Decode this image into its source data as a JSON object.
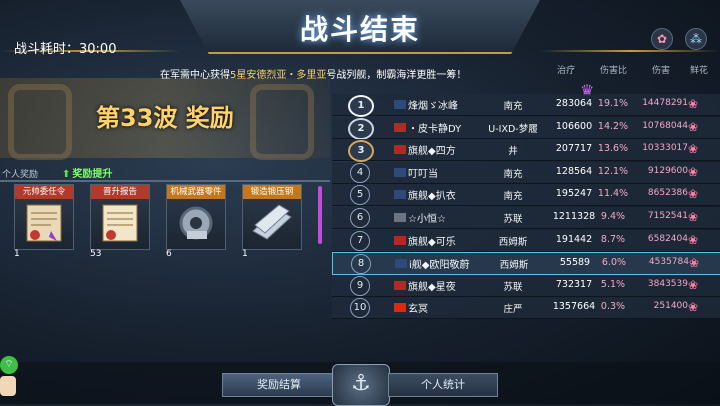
{
  "header": {
    "title": "战斗结束",
    "battle_time": "战斗耗时：30:00",
    "notice_prefix": "在军需中心获得",
    "notice_highlight": "5星安德烈亚・多里亚",
    "notice_suffix": "号战列舰，制霸海洋更胜一筹！"
  },
  "wave": {
    "label": "第33波 奖励"
  },
  "rewards": {
    "tab_personal": "个人奖励",
    "tab_boost": "奖励提升",
    "items": [
      {
        "label": "元帅委任令",
        "count": "1",
        "label_color": "red",
        "icon": "scroll-icon"
      },
      {
        "label": "晋升报告",
        "count": "53",
        "label_color": "red",
        "icon": "certificate-icon"
      },
      {
        "label": "机械武器零件",
        "count": "6",
        "label_color": "orange",
        "icon": "gear-part-icon"
      },
      {
        "label": "锻造锻压钢",
        "count": "1",
        "label_color": "orange",
        "icon": "steel-plate-icon"
      }
    ]
  },
  "table": {
    "columns": {
      "heal": "治疗",
      "ratio": "伤害比",
      "damage": "伤害",
      "flower": "鲜花"
    },
    "rows": [
      {
        "rank": "1",
        "name": "烽烟ゞ冰峰",
        "guild": "南充",
        "heal": "283064",
        "ratio": "19.1%",
        "damage": "14478291",
        "flag": "navy"
      },
      {
        "rank": "2",
        "name": "・皮卡静DY",
        "guild": "U-IXD-梦履",
        "heal": "106600",
        "ratio": "14.2%",
        "damage": "10768044",
        "flag": "red"
      },
      {
        "rank": "3",
        "name": "旗舰◆四方",
        "guild": "井",
        "heal": "207717",
        "ratio": "13.6%",
        "damage": "10333017",
        "flag": "red"
      },
      {
        "rank": "4",
        "name": "叮叮当",
        "guild": "南充",
        "heal": "128564",
        "ratio": "12.1%",
        "damage": "9129600",
        "flag": "navy"
      },
      {
        "rank": "5",
        "name": "旗舰◆扒衣",
        "guild": "南充",
        "heal": "195247",
        "ratio": "11.4%",
        "damage": "8652386",
        "flag": "navy"
      },
      {
        "rank": "6",
        "name": "☆小恒☆",
        "guild": "苏联",
        "heal": "1211328",
        "ratio": "9.4%",
        "damage": "7152541",
        "flag": "gray"
      },
      {
        "rank": "7",
        "name": "旗舰◆可乐",
        "guild": "西姆斯",
        "heal": "191442",
        "ratio": "8.7%",
        "damage": "6582404",
        "flag": "red"
      },
      {
        "rank": "8",
        "name": "i舰◆欧阳敬蔚",
        "guild": "西姆斯",
        "heal": "55589",
        "ratio": "6.0%",
        "damage": "4535784",
        "flag": "navy"
      },
      {
        "rank": "9",
        "name": "旗舰◆星夜",
        "guild": "苏联",
        "heal": "732317",
        "ratio": "5.1%",
        "damage": "3843539",
        "flag": "red"
      },
      {
        "rank": "10",
        "name": "玄冥",
        "guild": "庄严",
        "heal": "1357664",
        "ratio": "0.3%",
        "damage": "251400",
        "flag": "china"
      }
    ]
  },
  "bottom": {
    "settle_label": "奖励结算",
    "stats_label": "个人统计"
  },
  "colors": {
    "gold": "#c89b3c",
    "pink": "#f3a8c8",
    "green": "#7dff6a",
    "select_border": "#57c3e6"
  }
}
